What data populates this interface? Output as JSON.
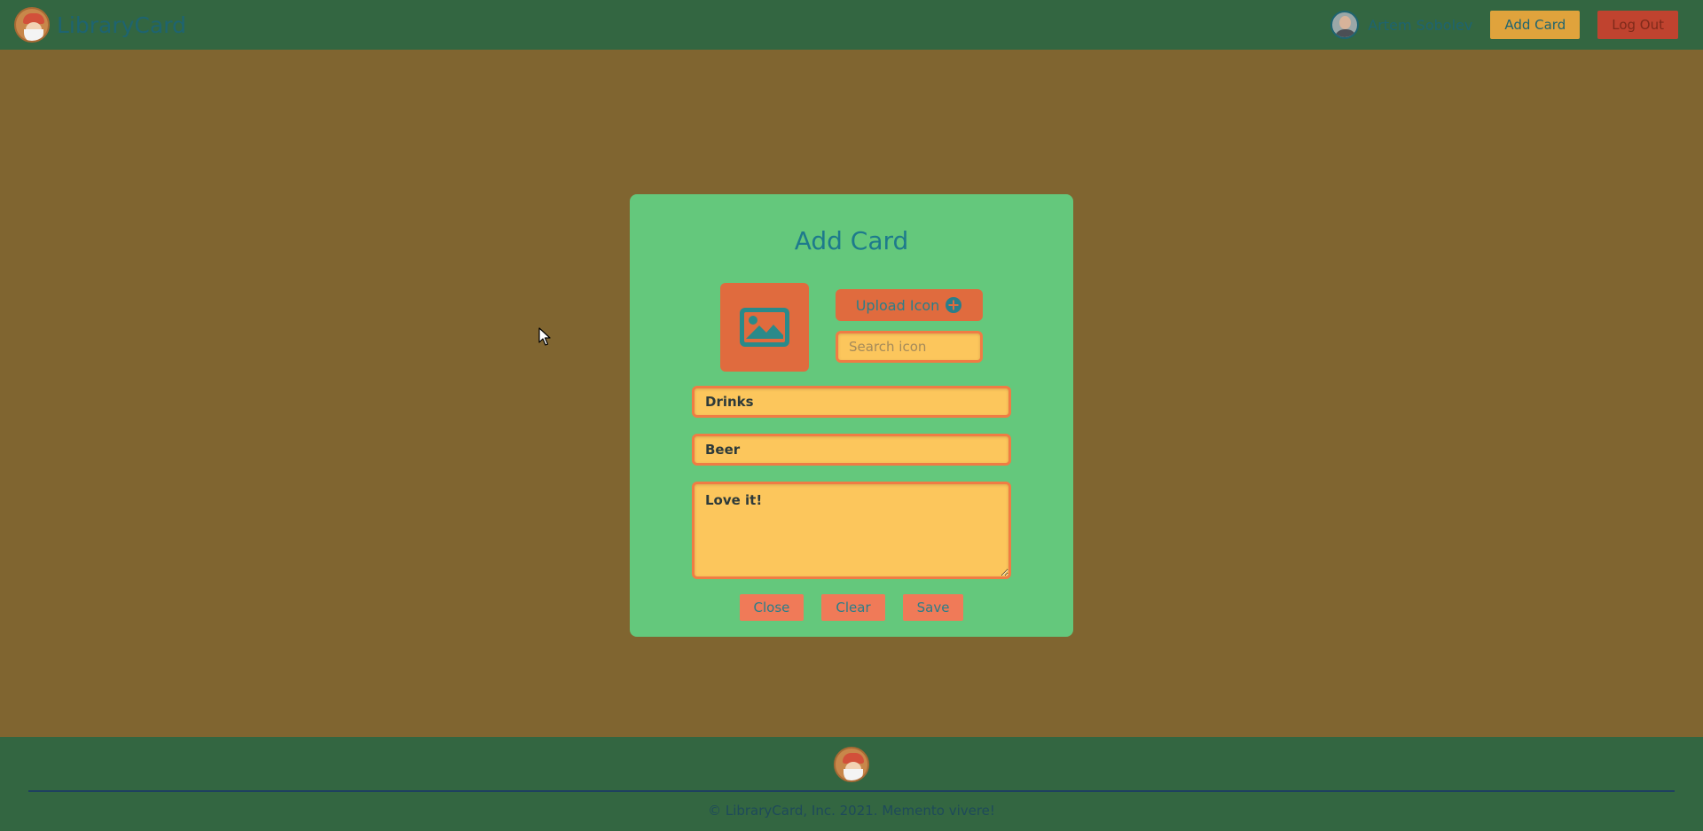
{
  "header": {
    "brand": "LibraryCard",
    "user_name": "Artem Sobolev",
    "add_card_label": "Add Card",
    "logout_label": "Log Out"
  },
  "modal": {
    "title": "Add Card",
    "upload_label": "Upload Icon",
    "search_placeholder": "Search icon",
    "category_value": "Drinks",
    "name_value": "Beer",
    "description_value": "Love it!",
    "close_label": "Close",
    "clear_label": "Clear",
    "save_label": "Save"
  },
  "footer": {
    "copyright": "© LibraryCard, Inc. 2021. Memento vivere!"
  },
  "icons": {
    "logo": "librarycard-logo-icon",
    "avatar": "user-avatar",
    "image_placeholder": "image-icon",
    "upload": "plus-circle-icon",
    "cursor": "mouse-cursor-icon"
  },
  "colors": {
    "background": "#806530",
    "header": "#336641",
    "modal": "#64c87c",
    "accent_orange": "#e06b3e",
    "input_fill": "#fcc65c",
    "teal_text": "#1e7a8c"
  }
}
